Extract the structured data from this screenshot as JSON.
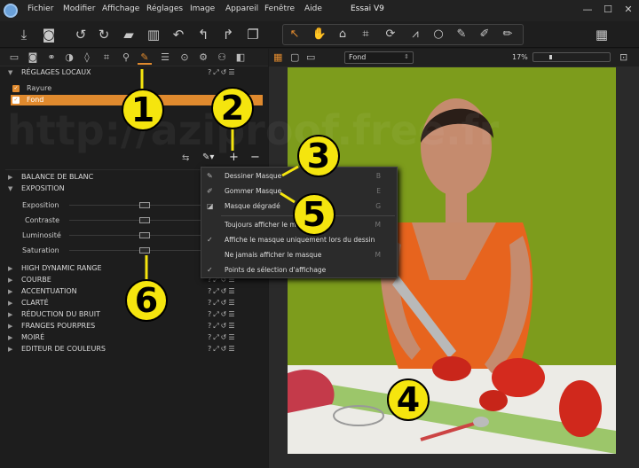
{
  "window": {
    "title": "Essai V9",
    "minimize": "—",
    "maximize": "☐",
    "close": "✕"
  },
  "menu": [
    "Fichier",
    "Modifier",
    "Affichage",
    "Réglages",
    "Image",
    "Appareil",
    "Fenêtre",
    "Aide"
  ],
  "watermark": "http://aziproof.free.fr",
  "left_panel": {
    "local_adjustments_title": "RÉGLAGES LOCAUX",
    "layers": [
      "Rayure",
      "Fond"
    ],
    "sections_before": [
      "BALANCE DE BLANC",
      "EXPOSITION"
    ],
    "sliders": [
      "Exposition",
      "Contraste",
      "Luminosité",
      "Saturation"
    ],
    "sections_after": [
      "HIGH DYNAMIC RANGE",
      "COURBE",
      "ACCENTUATION",
      "CLARTÉ",
      "RÉDUCTION DU BRUIT",
      "FRANGES POURPRES",
      "MOIRÉ",
      "EDITEUR DE COULEURS"
    ]
  },
  "dropdown": {
    "items": [
      {
        "label": "Dessiner Masque",
        "key": "B",
        "icon": "brush-icon"
      },
      {
        "label": "Gommer Masque",
        "key": "E",
        "icon": "eraser-icon"
      },
      {
        "label": "Masque dégradé",
        "key": "G",
        "icon": "gradient-icon"
      },
      {
        "label": "Toujours afficher le masque",
        "key": "M",
        "icon": ""
      },
      {
        "label": "Affiche le masque uniquement lors du dessin",
        "key": "",
        "icon": "check-icon"
      },
      {
        "label": "Ne jamais afficher le masque",
        "key": "M",
        "icon": ""
      },
      {
        "label": "Points de sélection d'affichage",
        "key": "",
        "icon": "check-icon"
      }
    ]
  },
  "viewer": {
    "layer_select": "Fond",
    "zoom": "17%"
  },
  "callouts": [
    "1",
    "2",
    "3",
    "4",
    "5",
    "6"
  ],
  "colors": {
    "accent": "#e08a2e",
    "callout": "#f5e50e",
    "background": "#1b1b1b"
  }
}
